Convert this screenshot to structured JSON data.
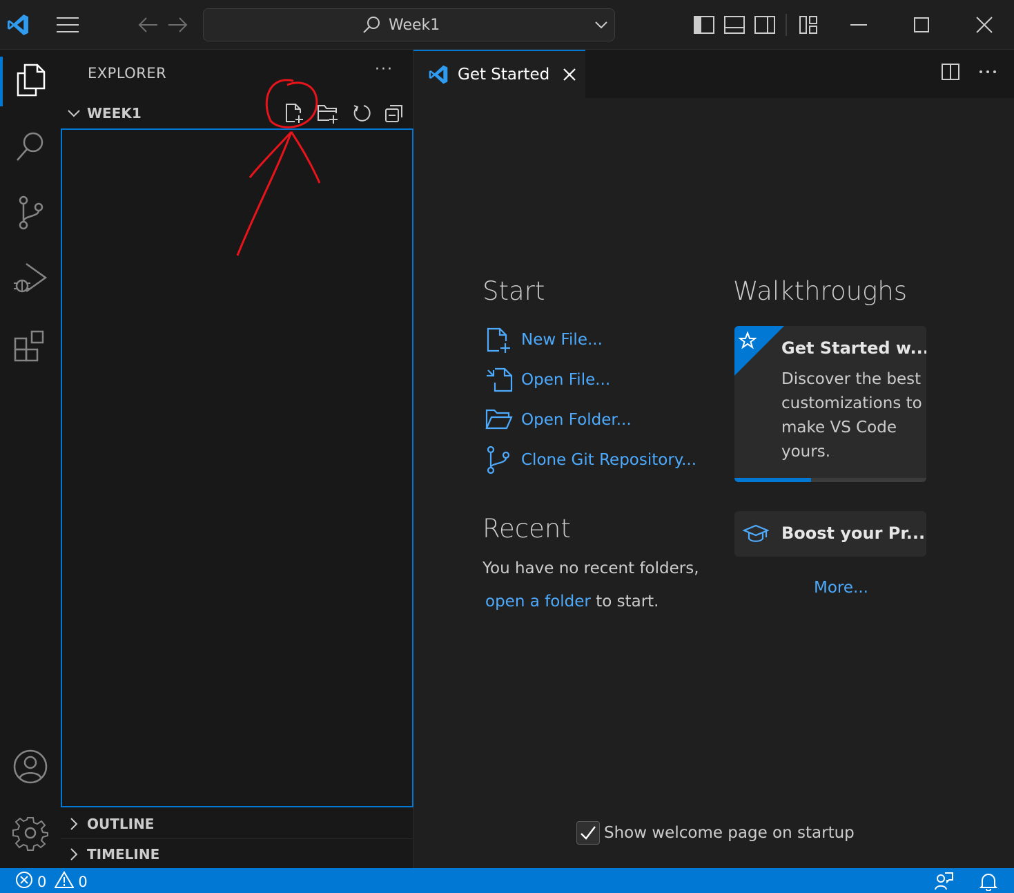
{
  "titlebar": {
    "search_text": "Week1"
  },
  "activity_bar": {
    "items": [
      "explorer-icon",
      "search-icon",
      "source-control-icon",
      "run-debug-icon",
      "extensions-icon"
    ],
    "bottom": [
      "accounts-icon",
      "manage-gear-icon"
    ]
  },
  "sidebar": {
    "title": "EXPLORER",
    "more": "···",
    "folder": "WEEK1",
    "outline": "OUTLINE",
    "timeline": "TIMELINE"
  },
  "editor": {
    "tab_label": "Get Started",
    "start": {
      "heading": "Start",
      "items": [
        "New File...",
        "Open File...",
        "Open Folder...",
        "Clone Git Repository..."
      ]
    },
    "recent": {
      "heading": "Recent",
      "line1": "You have no recent folders,",
      "link": "open a folder",
      "suffix": "to start."
    },
    "walkthroughs": {
      "heading": "Walkthroughs",
      "card1_title": "Get Started w...",
      "card1_desc": "Discover the best customizations to make VS Code yours.",
      "card1_progress": 0.4,
      "card2_title": "Boost your Pr...",
      "more": "More..."
    },
    "show_welcome_label": "Show welcome page on startup",
    "show_welcome_checked": true
  },
  "statusbar": {
    "errors": "0",
    "warnings": "0"
  },
  "colors": {
    "accent": "#0078d4",
    "link": "#4daafc",
    "annotation": "#e8141c"
  }
}
